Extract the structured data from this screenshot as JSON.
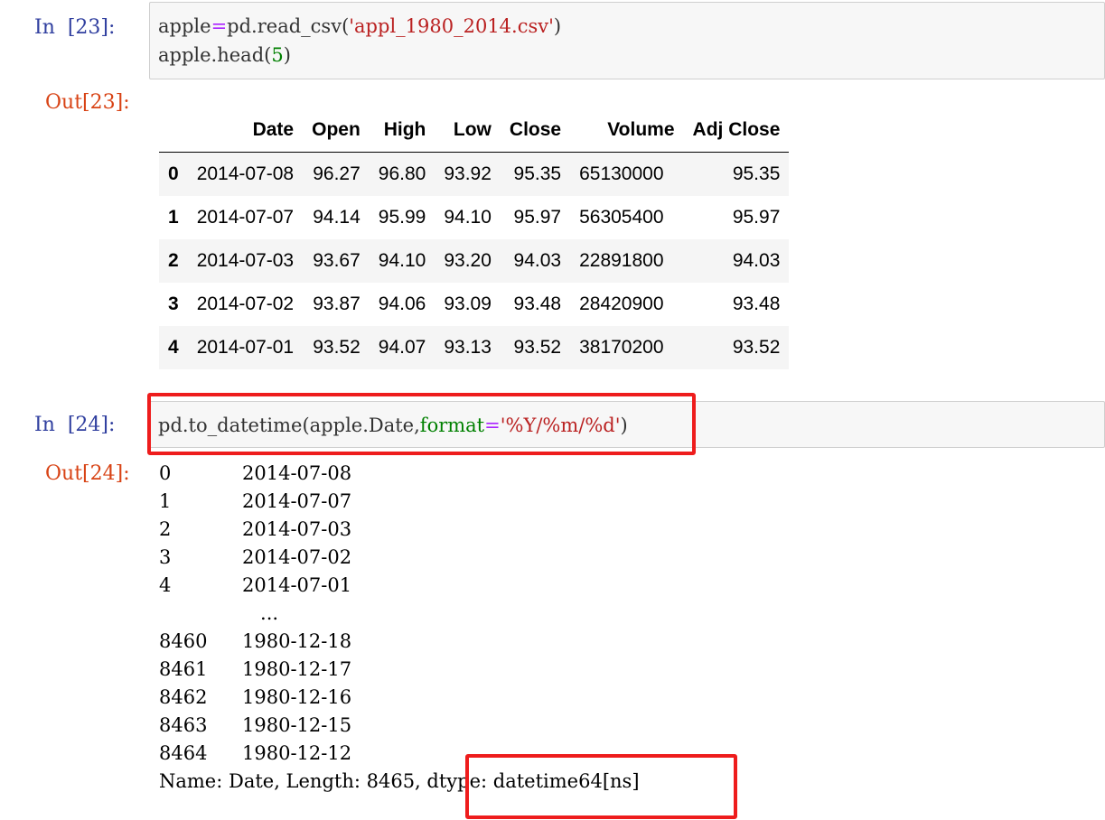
{
  "cell23": {
    "in_prompt": "In  [23]:",
    "out_prompt": "Out[23]:",
    "code_line1": {
      "part1": "apple",
      "op": "=",
      "part2": "pd.read_csv(",
      "string": "'appl_1980_2014.csv'",
      "part3": ")"
    },
    "code_line2": {
      "part1": "apple.head(",
      "number": "5",
      "part2": ")"
    },
    "table": {
      "columns": [
        "",
        "Date",
        "Open",
        "High",
        "Low",
        "Close",
        "Volume",
        "Adj Close"
      ],
      "rows": [
        [
          "0",
          "2014-07-08",
          "96.27",
          "96.80",
          "93.92",
          "95.35",
          "65130000",
          "95.35"
        ],
        [
          "1",
          "2014-07-07",
          "94.14",
          "95.99",
          "94.10",
          "95.97",
          "56305400",
          "95.97"
        ],
        [
          "2",
          "2014-07-03",
          "93.67",
          "94.10",
          "93.20",
          "94.03",
          "22891800",
          "94.03"
        ],
        [
          "3",
          "2014-07-02",
          "93.87",
          "94.06",
          "93.09",
          "93.48",
          "28420900",
          "93.48"
        ],
        [
          "4",
          "2014-07-01",
          "93.52",
          "94.07",
          "93.13",
          "93.52",
          "38170200",
          "93.52"
        ]
      ]
    }
  },
  "cell24": {
    "in_prompt": "In  [24]:",
    "out_prompt": "Out[24]:",
    "code": {
      "part1": "pd.to_datetime(apple.Date,",
      "kwarg": "format",
      "op": "=",
      "string": "'%Y/%m/%d'",
      "part2": ")"
    },
    "output_lines": [
      {
        "index": "0",
        "value": "2014-07-08"
      },
      {
        "index": "1",
        "value": "2014-07-07"
      },
      {
        "index": "2",
        "value": "2014-07-03"
      },
      {
        "index": "3",
        "value": "2014-07-02"
      },
      {
        "index": "4",
        "value": "2014-07-01"
      },
      {
        "index": "",
        "value": "   ..."
      },
      {
        "index": "8460",
        "value": "1980-12-18"
      },
      {
        "index": "8461",
        "value": "1980-12-17"
      },
      {
        "index": "8462",
        "value": "1980-12-16"
      },
      {
        "index": "8463",
        "value": "1980-12-15"
      },
      {
        "index": "8464",
        "value": "1980-12-12"
      }
    ],
    "footer": "Name: Date, Length: 8465, dtype: datetime64[ns]"
  },
  "colors": {
    "in_prompt": "#303F9F",
    "out_prompt": "#D84315",
    "string": "#BA2121",
    "number": "#008000",
    "highlight": "#ee1c1c"
  }
}
